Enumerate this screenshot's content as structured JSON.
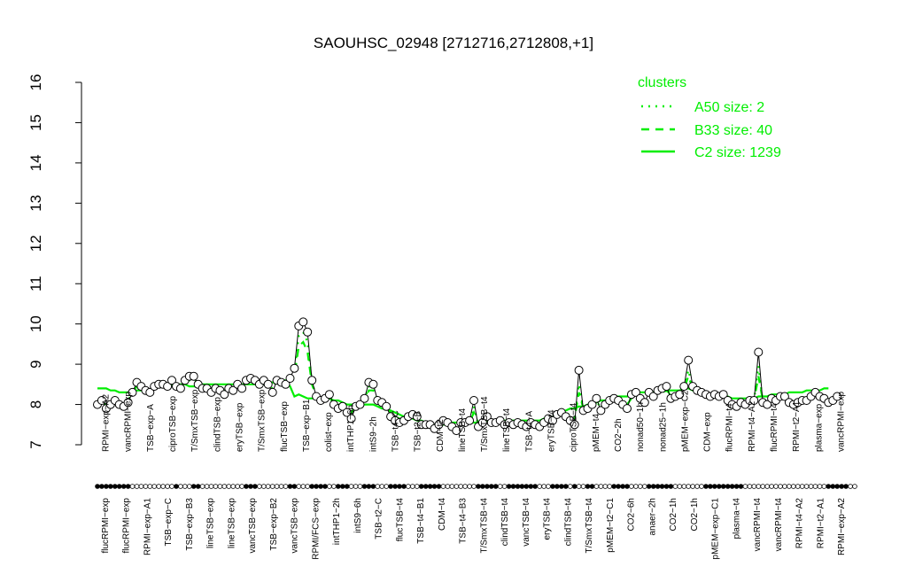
{
  "chart_data": {
    "type": "line",
    "title": "SAOUHSC_02948 [2712716,2712808,+1]",
    "xlabel": "",
    "ylabel": "",
    "ylim": [
      7,
      16
    ],
    "y_ticks": [
      7,
      8,
      9,
      10,
      11,
      12,
      13,
      14,
      15,
      16
    ],
    "legend": {
      "title": "clusters",
      "position": "top-right",
      "entries": [
        {
          "label": "A50 size: 2",
          "style": "dotted"
        },
        {
          "label": "B33 size: 40",
          "style": "dashed"
        },
        {
          "label": "C2 size: 1239",
          "style": "solid"
        }
      ]
    },
    "colors": {
      "cluster": "#00ee00",
      "series": "#000000",
      "axis": "#000000"
    },
    "top_tick_labels": [
      "RPMI−exp−A2",
      "vancRPMI−exp",
      "TSB−exp−A",
      "ciproTSB−exp",
      "T/SmxTSB−exp",
      "clindTSB−exp",
      "eryTSB−exp",
      "T/SmxTSB−exp",
      "flucTSB−exp",
      "TSB−exp−B1",
      "colist−exp",
      "intTHP1−6h",
      "intS9−2h",
      "TSB−t4−C",
      "TSB−t2−B",
      "CDM−t2",
      "lineTSB−t4",
      "T/SmxTSB−t4",
      "lineTSB−t4",
      "TSB−t4−A",
      "eryTSB−t4",
      "ciproTSB−t4",
      "pMEM−t4",
      "CO2−2h",
      "nonad50−1h",
      "nonad25−1h",
      "pMEM−exp−C2",
      "CDM−exp",
      "flucRPMI−t4",
      "RPMI−t4−A2",
      "flucRPMI−t4",
      "RPMI−t2−A1",
      "plasma−exp",
      "vancRPMI−exp"
    ],
    "bottom_tick_labels": [
      "flucRPMI−exp",
      "flucRPMI−exp",
      "RPMI−exp−A1",
      "TSB−exp−C",
      "TSB−exp−B3",
      "lineTSB−exp",
      "lineTSB−exp",
      "vancTSB−exp",
      "TSB−exp−B2",
      "vancTSB−exp",
      "RPMI/FCS−exp",
      "intTHP1−2h",
      "intS9−6h",
      "TSB−t2−C",
      "flucTSB−t4",
      "TSB−t4−B1",
      "CDM−t4",
      "TSB−t4−B3",
      "T/SmxTSB−t4",
      "clindTSB−t4",
      "vancTSB−t4",
      "eryTSB−t4",
      "clindTSB−t4",
      "T/SmxTSB−t4",
      "pMEM−t2−C1",
      "CO2−6h",
      "anaer−2h",
      "CO2−1h",
      "CO2−1h",
      "pMEM−exp−C1",
      "plasma−t4",
      "vancRPMI−t4",
      "vancRPMI−t4",
      "RPMI−t4−A2",
      "RPMI−t2−A1",
      "RPMI−exp−A2"
    ],
    "x": [
      0,
      1,
      2,
      3,
      4,
      5,
      6,
      7,
      8,
      9,
      10,
      11,
      12,
      13,
      14,
      15,
      16,
      17,
      18,
      19,
      20,
      21,
      22,
      23,
      24,
      25,
      26,
      27,
      28,
      29,
      30,
      31,
      32,
      33,
      34,
      35,
      36,
      37,
      38,
      39,
      40,
      41,
      42,
      43,
      44,
      45,
      46,
      47,
      48,
      49,
      50,
      51,
      52,
      53,
      54,
      55,
      56,
      57,
      58,
      59,
      60,
      61,
      62,
      63,
      64,
      65,
      66,
      67,
      68,
      69,
      70,
      71,
      72,
      73,
      74,
      75,
      76,
      77,
      78,
      79,
      80,
      81,
      82,
      83,
      84,
      85,
      86,
      87,
      88,
      89,
      90,
      91,
      92,
      93,
      94,
      95,
      96,
      97,
      98,
      99,
      100,
      101,
      102,
      103,
      104,
      105,
      106,
      107,
      108,
      109,
      110,
      111,
      112,
      113,
      114,
      115,
      116,
      117,
      118,
      119,
      120,
      121,
      122,
      123,
      124,
      125,
      126,
      127,
      128,
      129,
      130,
      131,
      132,
      133,
      134,
      135,
      136,
      137,
      138,
      139,
      140,
      141,
      142,
      143,
      144,
      145,
      146,
      147,
      148,
      149,
      150,
      151,
      152,
      153,
      154,
      155,
      156,
      157,
      158,
      159,
      160,
      161,
      162,
      163,
      164,
      165,
      166,
      167,
      168,
      169,
      170,
      171,
      172,
      173
    ],
    "series": [
      {
        "name": "",
        "style": "points-line",
        "values": [
          8.0,
          8.1,
          7.9,
          8.0,
          8.1,
          8.0,
          7.95,
          8.05,
          8.3,
          8.55,
          8.45,
          8.35,
          8.3,
          8.45,
          8.5,
          8.5,
          8.45,
          8.6,
          8.45,
          8.4,
          8.6,
          8.7,
          8.7,
          8.5,
          8.4,
          8.4,
          8.3,
          8.4,
          8.35,
          8.25,
          8.4,
          8.35,
          8.5,
          8.4,
          8.6,
          8.65,
          8.6,
          8.5,
          8.6,
          8.5,
          8.3,
          8.6,
          8.55,
          8.5,
          8.65,
          8.9,
          9.95,
          10.05,
          9.8,
          8.6,
          8.2,
          8.1,
          8.15,
          8.25,
          8.0,
          7.9,
          7.95,
          7.8,
          7.65,
          7.95,
          8.0,
          8.15,
          8.55,
          8.5,
          8.1,
          8.05,
          7.95,
          7.7,
          7.6,
          7.55,
          7.6,
          7.7,
          7.75,
          7.7,
          7.5,
          7.5,
          7.5,
          7.4,
          7.5,
          7.6,
          7.55,
          7.45,
          7.35,
          7.55,
          7.55,
          7.6,
          8.1,
          7.45,
          7.55,
          7.7,
          7.55,
          7.55,
          7.6,
          7.5,
          7.55,
          7.5,
          7.55,
          7.5,
          7.45,
          7.55,
          7.5,
          7.45,
          7.55,
          7.65,
          7.6,
          7.75,
          7.8,
          7.7,
          7.6,
          7.5,
          8.85,
          7.85,
          7.9,
          8.0,
          8.15,
          7.85,
          8.0,
          8.1,
          8.15,
          8.1,
          8.0,
          7.9,
          8.25,
          8.3,
          8.15,
          8.05,
          8.3,
          8.2,
          8.35,
          8.4,
          8.45,
          8.15,
          8.2,
          8.25,
          8.45,
          9.1,
          8.45,
          8.35,
          8.3,
          8.25,
          8.2,
          8.25,
          8.2,
          8.25,
          8.1,
          8.0,
          7.95,
          8.05,
          8.0,
          8.1,
          8.1,
          9.3,
          8.05,
          8.0,
          8.15,
          8.1,
          8.2,
          8.2,
          8.05,
          8.0,
          8.05,
          8.1,
          8.1,
          8.2,
          8.3,
          8.2,
          8.15,
          8.05,
          8.1,
          8.2
        ]
      },
      {
        "name": "",
        "style": "solid",
        "values": [
          8.4,
          8.4,
          8.4,
          8.35,
          8.35,
          8.3,
          8.3,
          8.3,
          8.3,
          8.35,
          8.35,
          8.35,
          8.35,
          8.4,
          8.45,
          8.45,
          8.45,
          8.5,
          8.5,
          8.5,
          8.5,
          8.45,
          8.45,
          8.45,
          8.5,
          8.5,
          8.5,
          8.5,
          8.5,
          8.5,
          8.5,
          8.5,
          8.5,
          8.5,
          8.5,
          8.5,
          8.5,
          8.5,
          8.5,
          8.55,
          8.55,
          8.55,
          8.6,
          8.6,
          8.45,
          8.2,
          8.25,
          8.2,
          8.15,
          8.15,
          8.15,
          8.15,
          8.15,
          8.15,
          8.1,
          8.1,
          8.05,
          8.0,
          8.0,
          8.0,
          8.0,
          8.0,
          8.0,
          8.0,
          7.95,
          7.9,
          7.9,
          7.85,
          7.8,
          7.75,
          7.7,
          7.7,
          7.65,
          7.6,
          7.6,
          7.55,
          7.55,
          7.5,
          7.5,
          7.5,
          7.5,
          7.55,
          7.55,
          7.55,
          7.55,
          7.55,
          7.55,
          7.55,
          7.55,
          7.6,
          7.6,
          7.6,
          7.6,
          7.6,
          7.6,
          7.6,
          7.6,
          7.6,
          7.6,
          7.6,
          7.6,
          7.6,
          7.65,
          7.65,
          7.7,
          7.75,
          7.8,
          7.85,
          7.9,
          7.9,
          7.95,
          7.95,
          8.0,
          8.0,
          8.05,
          8.1,
          8.1,
          8.15,
          8.15,
          8.2,
          8.2,
          8.2,
          8.25,
          8.25,
          8.3,
          8.3,
          8.3,
          8.3,
          8.35,
          8.35,
          8.35,
          8.35,
          8.35,
          8.35,
          8.4,
          8.4,
          8.35,
          8.35,
          8.3,
          8.3,
          8.25,
          8.25,
          8.2,
          8.2,
          8.2,
          8.15,
          8.15,
          8.15,
          8.15,
          8.15,
          8.15,
          8.2,
          8.2,
          8.2,
          8.25,
          8.25,
          8.25,
          8.25,
          8.3,
          8.3,
          8.3,
          8.3,
          8.35,
          8.35,
          8.35,
          8.35,
          8.4,
          8.4
        ]
      },
      {
        "name": "",
        "style": "dashed",
        "values": [
          8.1,
          8.1,
          8.05,
          8.05,
          8.1,
          8.05,
          8.05,
          8.1,
          8.3,
          8.45,
          8.4,
          8.35,
          8.35,
          8.4,
          8.45,
          8.45,
          8.45,
          8.5,
          8.45,
          8.45,
          8.55,
          8.6,
          8.6,
          8.5,
          8.45,
          8.45,
          8.4,
          8.4,
          8.4,
          8.35,
          8.4,
          8.4,
          8.45,
          8.45,
          8.55,
          8.6,
          8.55,
          8.5,
          8.55,
          8.55,
          8.5,
          8.55,
          8.55,
          8.55,
          8.6,
          8.7,
          9.45,
          9.55,
          9.3,
          8.5,
          8.2,
          8.15,
          8.15,
          8.2,
          8.05,
          8.0,
          7.95,
          7.9,
          7.8,
          7.95,
          8.0,
          8.1,
          8.35,
          8.35,
          8.1,
          8.0,
          7.95,
          7.8,
          7.7,
          7.65,
          7.65,
          7.7,
          7.7,
          7.65,
          7.55,
          7.55,
          7.5,
          7.45,
          7.5,
          7.55,
          7.55,
          7.5,
          7.45,
          7.5,
          7.55,
          7.55,
          7.8,
          7.55,
          7.55,
          7.6,
          7.55,
          7.55,
          7.55,
          7.5,
          7.55,
          7.5,
          7.5,
          7.5,
          7.5,
          7.5,
          7.5,
          7.5,
          7.55,
          7.6,
          7.6,
          7.7,
          7.75,
          7.7,
          7.65,
          7.65,
          8.3,
          7.9,
          7.9,
          7.95,
          8.05,
          7.95,
          8.0,
          8.05,
          8.1,
          8.1,
          8.05,
          8.0,
          8.15,
          8.2,
          8.15,
          8.1,
          8.2,
          8.2,
          8.25,
          8.3,
          8.35,
          8.25,
          8.25,
          8.3,
          8.4,
          8.7,
          8.4,
          8.35,
          8.3,
          8.25,
          8.2,
          8.2,
          8.2,
          8.2,
          8.1,
          8.05,
          8.0,
          8.05,
          8.0,
          8.05,
          8.1,
          8.7,
          8.1,
          8.05,
          8.1,
          8.1,
          8.15,
          8.15,
          8.1,
          8.05,
          8.05,
          8.1,
          8.1,
          8.15,
          8.2,
          8.2,
          8.15,
          8.1,
          8.1,
          8.15
        ]
      },
      {
        "name": "",
        "style": "dotted",
        "values": [
          8.05,
          8.05,
          8.0,
          8.05,
          8.1,
          8.05,
          8.0,
          8.05,
          8.25,
          8.5,
          8.45,
          8.35,
          8.3,
          8.45,
          8.5,
          8.5,
          8.45,
          8.55,
          8.45,
          8.4,
          8.55,
          8.65,
          8.65,
          8.5,
          8.4,
          8.4,
          8.35,
          8.4,
          8.35,
          8.3,
          8.4,
          8.35,
          8.5,
          8.45,
          8.55,
          8.6,
          8.55,
          8.5,
          8.55,
          8.5,
          8.4,
          8.6,
          8.55,
          8.5,
          8.6,
          8.8,
          9.7,
          9.8,
          9.55,
          8.55,
          8.2,
          8.1,
          8.15,
          8.2,
          8.0,
          7.95,
          7.95,
          7.85,
          7.7,
          7.95,
          8.0,
          8.1,
          8.45,
          8.4,
          8.1,
          8.05,
          7.95,
          7.75,
          7.65,
          7.6,
          7.6,
          7.7,
          7.75,
          7.7,
          7.55,
          7.5,
          7.5,
          7.45,
          7.5,
          7.6,
          7.55,
          7.5,
          7.4,
          7.55,
          7.55,
          7.6,
          7.95,
          7.5,
          7.55,
          7.65,
          7.55,
          7.55,
          7.6,
          7.5,
          7.55,
          7.5,
          7.55,
          7.5,
          7.5,
          7.55,
          7.5,
          7.5,
          7.55,
          7.65,
          7.6,
          7.75,
          7.8,
          7.75,
          7.7,
          7.6,
          8.5,
          7.9,
          7.9,
          8.0,
          8.1,
          7.9,
          8.0,
          8.05,
          8.1,
          8.1,
          8.0,
          7.95,
          8.2,
          8.25,
          8.15,
          8.05,
          8.25,
          8.2,
          8.3,
          8.35,
          8.4,
          8.2,
          8.2,
          8.25,
          8.4,
          8.85,
          8.4,
          8.35,
          8.3,
          8.25,
          8.2,
          8.25,
          8.2,
          8.2,
          8.1,
          8.0,
          7.95,
          8.05,
          8.0,
          8.1,
          8.1,
          8.95,
          8.05,
          8.0,
          8.1,
          8.1,
          8.15,
          8.15,
          8.05,
          8.0,
          8.05,
          8.1,
          8.1,
          8.2,
          8.25,
          8.2,
          8.15,
          8.05,
          8.1,
          8.2
        ]
      }
    ],
    "marker_rows": {
      "top": [
        1,
        1,
        1,
        1,
        1,
        1,
        1,
        1,
        0,
        0,
        0,
        0,
        0,
        0,
        0,
        0,
        0,
        0,
        1,
        0,
        0,
        0,
        1,
        1,
        0,
        0,
        0,
        0,
        0,
        0,
        0,
        0,
        0,
        0,
        1,
        1,
        1,
        0,
        0,
        0,
        0,
        0,
        0,
        0,
        1,
        1,
        0,
        0,
        0,
        1,
        1,
        1,
        1,
        0,
        0,
        1,
        1,
        1,
        0,
        0,
        0,
        1,
        1,
        1,
        0,
        0,
        0,
        1,
        1,
        1,
        1,
        0,
        0,
        0,
        1,
        1,
        1,
        1,
        1,
        0,
        0,
        0,
        0,
        0,
        0,
        0,
        0,
        1,
        1,
        1,
        1,
        1,
        0,
        0,
        1,
        1,
        1,
        1,
        1,
        1,
        1,
        0,
        0,
        0,
        1,
        1,
        1,
        1,
        0,
        1,
        0,
        0,
        1,
        1,
        0,
        0,
        0,
        0,
        1,
        1,
        1,
        1,
        0,
        0,
        0,
        0,
        1,
        1,
        1,
        1,
        1,
        1,
        0,
        0,
        0,
        0,
        0,
        0,
        0,
        1,
        1,
        1,
        1,
        1,
        1,
        1,
        1,
        1,
        0,
        0,
        0,
        0,
        0,
        0,
        0,
        0,
        0,
        0,
        0,
        0,
        0,
        0,
        0,
        0,
        0,
        0,
        0,
        1,
        1,
        1,
        1,
        1,
        0,
        0
      ]
    }
  }
}
